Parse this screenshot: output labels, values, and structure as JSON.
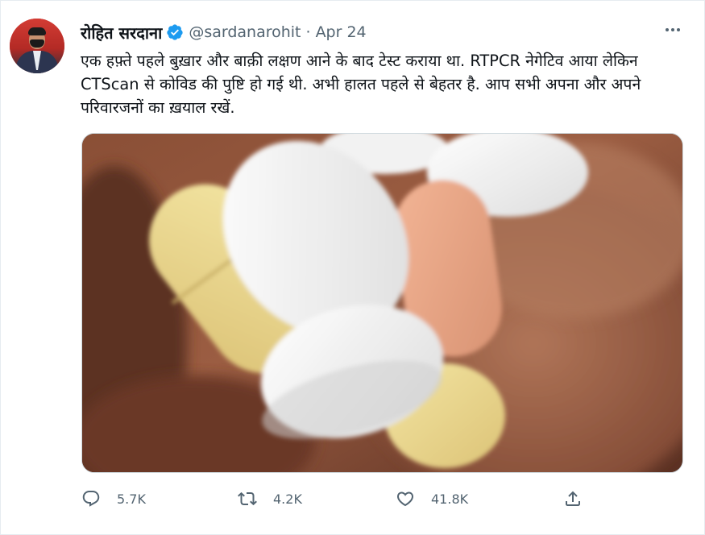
{
  "tweet": {
    "author_name": "रोहित सरदाना",
    "handle": "@sardanarohit",
    "separator": "·",
    "date": "Apr 24",
    "verified": true,
    "text": "एक हफ़्ते पहले बुख़ार और बाक़ी लक्षण आने के बाद टेस्ट कराया था. RTPCR नेगेटिव आया लेकिन CTScan से कोविड की पुष्टि हो गई थी. अभी हालत पहले से बेहतर है. आप सभी अपना और अपने परिवारजनों का ख़याल रखें.",
    "media_description": "close-up photo of pills in a hand",
    "actions": {
      "reply_count": "5.7K",
      "retweet_count": "4.2K",
      "like_count": "41.8K"
    }
  },
  "colors": {
    "verified_blue": "#1d9bf0",
    "secondary_text": "#536471",
    "primary_text": "#0f1419"
  },
  "icons": {
    "reply": "reply-icon",
    "retweet": "retweet-icon",
    "like": "heart-icon",
    "share": "share-icon",
    "more": "more-icon",
    "verified": "verified-badge-icon"
  }
}
